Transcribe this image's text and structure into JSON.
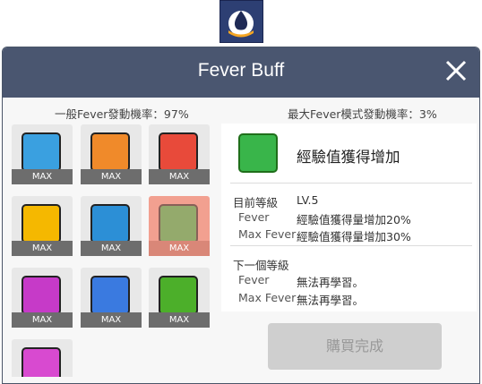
{
  "window": {
    "title": "Fever Buff",
    "close_icon": "close-icon"
  },
  "rates": {
    "normal": "一般Fever發動機率：97%",
    "max": "最大Fever模式發動機率：3%"
  },
  "skills": [
    {
      "icon": "running-icon",
      "badge": "MAX",
      "color": "#3aa0e0"
    },
    {
      "icon": "sword-up-icon",
      "badge": "MAX",
      "color": "#f08a2a"
    },
    {
      "icon": "hp-up-icon",
      "badge": "MAX",
      "color": "#e84a3a"
    },
    {
      "icon": "running-speed-icon",
      "badge": "MAX",
      "color": "#f5b800"
    },
    {
      "icon": "shield-up-icon",
      "badge": "MAX",
      "color": "#2c8fd6"
    },
    {
      "icon": "exp-up-icon",
      "badge": "MAX",
      "color": "#39b54a"
    },
    {
      "icon": "sword-purple-icon",
      "badge": "MAX",
      "color": "#c63ac8"
    },
    {
      "icon": "mp-up-icon",
      "badge": "MAX",
      "color": "#3a7ae0"
    },
    {
      "icon": "coin-up-icon",
      "badge": "MAX",
      "color": "#4caf2a"
    },
    {
      "icon": "sword-pink-icon",
      "badge": "",
      "color": "#d84ad0"
    }
  ],
  "selected": {
    "icon": "exp-up-icon",
    "name": "經驗值獲得增加",
    "current_title": "目前等級",
    "current_level": "LV.5",
    "current_rows": [
      {
        "label": "Fever",
        "value": "經驗值獲得量增加20%"
      },
      {
        "label": "Max Fever",
        "value": "經驗值獲得量增加30%"
      }
    ],
    "next_title": "下一個等級",
    "next_rows": [
      {
        "label": "Fever",
        "value": "無法再學習。"
      },
      {
        "label": "Max Fever",
        "value": "無法再學習。"
      }
    ]
  },
  "purchase_button": "購買完成"
}
